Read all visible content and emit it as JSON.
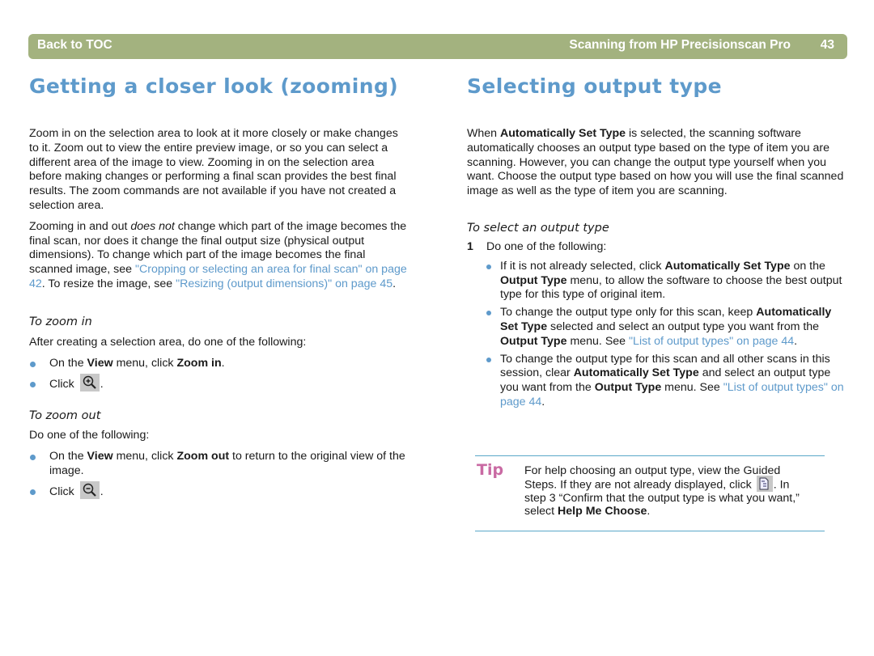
{
  "header": {
    "back_link": "Back to TOC",
    "doc_title": "Scanning from HP Precisionscan Pro",
    "page_number": "43"
  },
  "left": {
    "heading": "Getting a closer look (zooming)",
    "intro": "Zoom in on the selection area to look at it more closely or make changes to it. Zoom out to view the entire preview image, or so you can select a different area of the image to view. Zooming in on the selection area before making changes or performing a final scan provides the best final results. The zoom commands are not available if you have not created a selection area.",
    "para2": {
      "t1": "Zooming in and out ",
      "em": "does not",
      "t2": " change which part of the image becomes the final scan, nor does it change the final output size (physical output dimensions). To change which part of the image becomes the final scanned image, see ",
      "link1": "\"Cropping or selecting an area for final scan\" on page 42",
      "t3": ". To resize the image, see ",
      "link2": "\"Resizing (output dimensions)\" on page 45",
      "t4": "."
    },
    "zoom_in": {
      "heading": "To zoom in",
      "lead": "After creating a selection area, do one of the following:",
      "b1_t1": "On the ",
      "b1_view": "View",
      "b1_t2": " menu, click ",
      "b1_cmd": "Zoom in",
      "b1_t3": ".",
      "b2_click": "Click",
      "b2_end": ".",
      "icon": "zoom-in-icon"
    },
    "zoom_out": {
      "heading": "To zoom out",
      "lead": "Do one of the following:",
      "b1_t1": "On the ",
      "b1_view": "View",
      "b1_t2": " menu, click ",
      "b1_cmd": "Zoom out",
      "b1_t3": " to return to the original view of the image.",
      "b2_click": "Click",
      "b2_end": ".",
      "icon": "zoom-out-icon"
    }
  },
  "right": {
    "heading": "Selecting output type",
    "intro": {
      "t1": "When ",
      "b1": "Automatically Set Type",
      "t2": " is selected, the scanning software automatically chooses an output type based on the type of item you are scanning. However, you can change the output type yourself when you want. Choose the output type based on how you will use the final scanned image as well as the type of item you are scanning."
    },
    "procedure": {
      "heading": "To select an output type",
      "step_num": "1",
      "step_text": "Do one of the following:",
      "b1": {
        "t1": "If it is not already selected, click ",
        "k1": "Automatically Set Type",
        "t2": " on the ",
        "k2": "Output Type",
        "t3": " menu, to allow the software to choose the best output type for this type of original item."
      },
      "b2": {
        "t1": "To change the output type only for this scan, keep ",
        "k1": "Automatically Set Type",
        "t2": " selected and select an output type you want from the ",
        "k2": "Output Type",
        "t3": " menu. See ",
        "link": "\"List of output types\" on page 44",
        "t4": "."
      },
      "b3": {
        "t1": "To change the output type for this scan and all other scans in this session, clear ",
        "k1": "Automatically Set Type",
        "t2": " and select an output type you want from the ",
        "k2": "Output Type",
        "t3": " menu. See ",
        "link": "\"List of output types\" on page 44",
        "t4": "."
      }
    },
    "tip": {
      "label": "Tip",
      "t1": "For help choosing an output type, view the Guided Steps. If they are not already displayed, click ",
      "t2": ". In step 3 “Confirm that the output type is what you want,” select ",
      "k1": "Help Me Choose",
      "t3": ".",
      "icon": "guided-steps-icon"
    }
  },
  "colors": {
    "header_bg": "#a3b27f",
    "heading": "#5e9acb",
    "link": "#5e9acb",
    "tip_label": "#c96aa3",
    "tip_rule": "#5aa8c8"
  }
}
